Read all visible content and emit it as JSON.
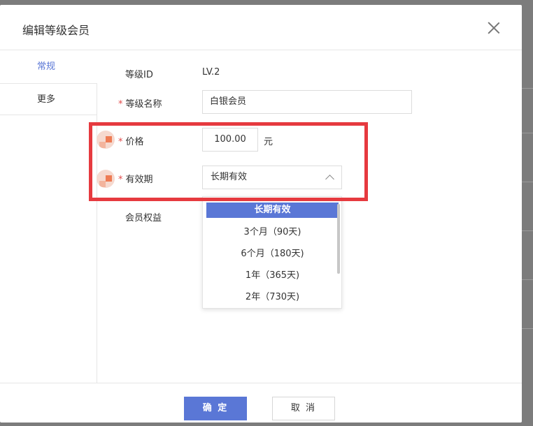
{
  "modal": {
    "title": "编辑等级会员"
  },
  "nav": {
    "tabs": [
      {
        "label": "常规",
        "active": true
      },
      {
        "label": "更多",
        "active": false
      }
    ]
  },
  "form": {
    "level_id": {
      "label": "等级ID",
      "value": "LV.2"
    },
    "level_name": {
      "label": "等级名称",
      "required": "*",
      "value": "白银会员"
    },
    "price": {
      "label": "价格",
      "required": "*",
      "value": "100.00",
      "unit": "元"
    },
    "validity": {
      "label": "有效期",
      "required": "*",
      "value": "长期有效"
    },
    "benefits": {
      "label": "会员权益"
    }
  },
  "dropdown": {
    "options": [
      "长期有效",
      "3个月（90天)",
      "6个月（180天)",
      "1年（365天)",
      "2年（730天)"
    ],
    "selected_index": 0
  },
  "footer": {
    "confirm_label": "确 定",
    "cancel_label": "取 消"
  },
  "colors": {
    "accent": "#5a77d6",
    "highlight": "#e63a3f",
    "required": "#e24b4b"
  }
}
